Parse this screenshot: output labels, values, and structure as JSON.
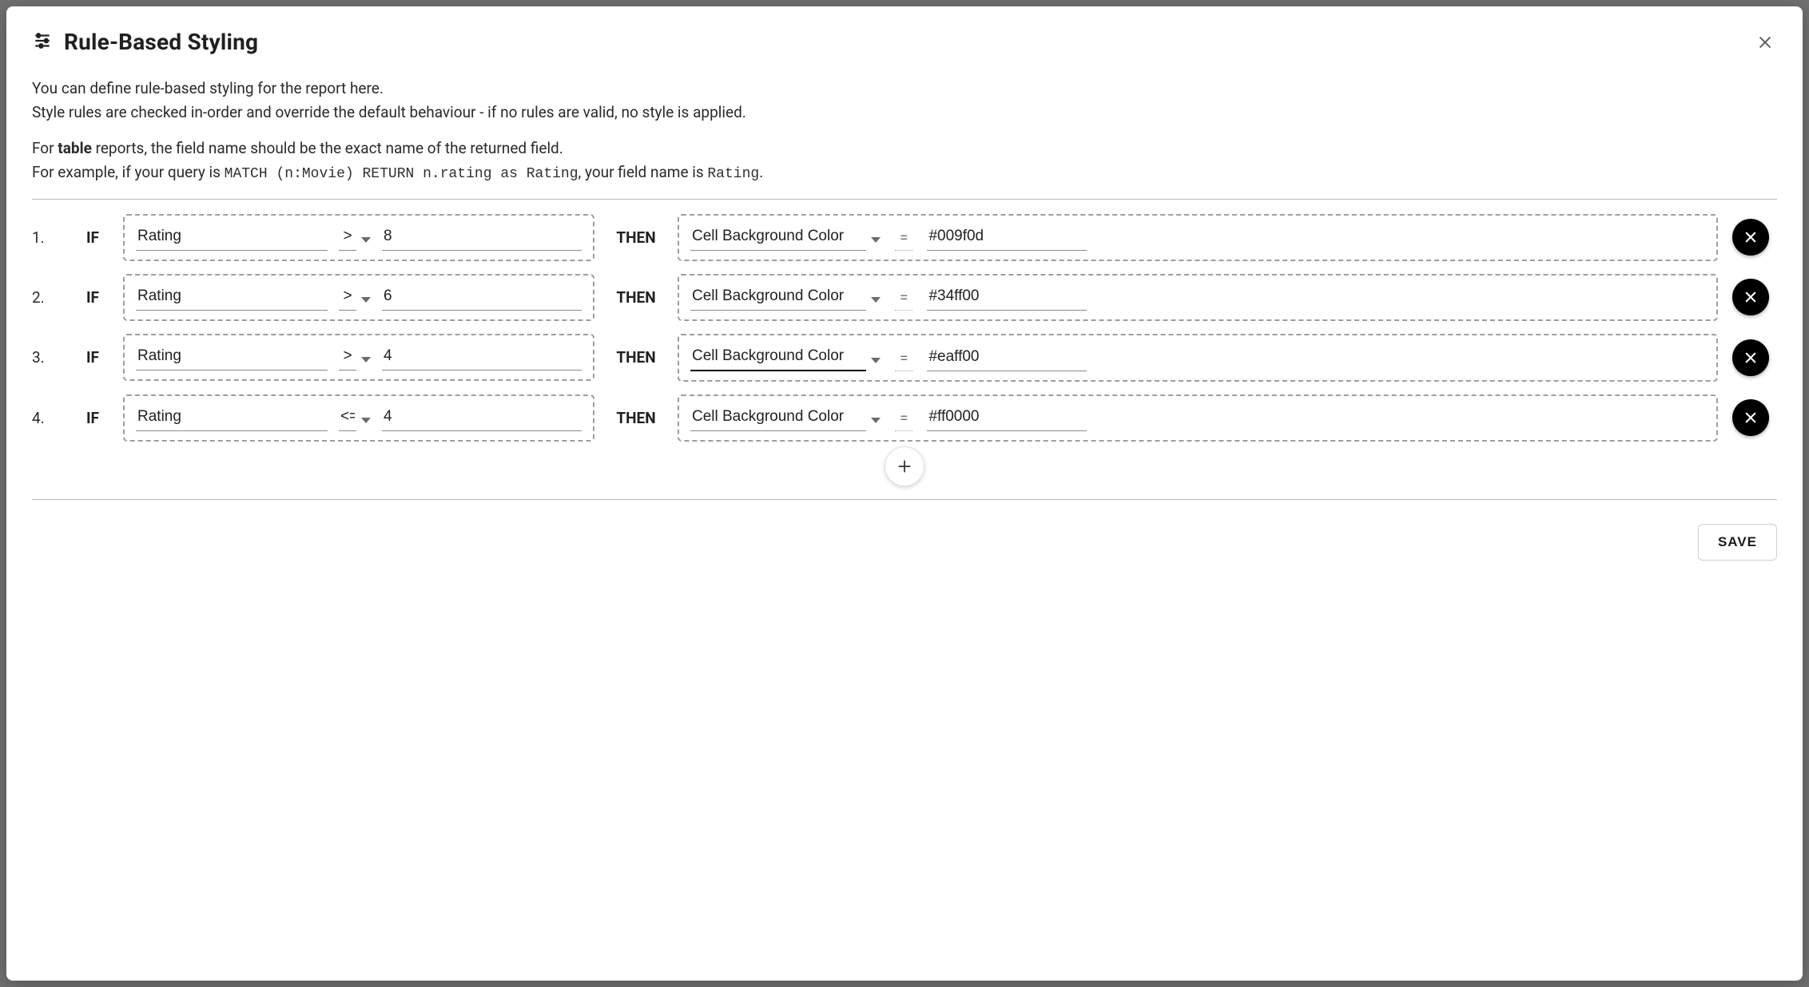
{
  "dialog": {
    "title": "Rule-Based Styling",
    "intro_line1": "You can define rule-based styling for the report here.",
    "intro_line2": "Style rules are checked in-order and override the default behaviour - if no rules are valid, no style is applied.",
    "intro_line3_pre": "For ",
    "intro_line3_bold": "table",
    "intro_line3_post": " reports, the field name should be the exact name of the returned field.",
    "intro_line4_pre": "For example, if your query is ",
    "intro_line4_code": "MATCH (n:Movie) RETURN n.rating as Rating",
    "intro_line4_mid": ", your field name is ",
    "intro_line4_code2": "Rating",
    "intro_line4_post": "."
  },
  "labels": {
    "if": "IF",
    "then": "THEN",
    "equals": "=",
    "save": "SAVE"
  },
  "rules": [
    {
      "index": "1.",
      "field": "Rating",
      "op": ">",
      "value": "8",
      "target": "Cell Background Color",
      "result": "#009f0d",
      "target_focused": false
    },
    {
      "index": "2.",
      "field": "Rating",
      "op": ">",
      "value": "6",
      "target": "Cell Background Color",
      "result": "#34ff00",
      "target_focused": false
    },
    {
      "index": "3.",
      "field": "Rating",
      "op": ">",
      "value": "4",
      "target": "Cell Background Color",
      "result": "#eaff00",
      "target_focused": true
    },
    {
      "index": "4.",
      "field": "Rating",
      "op": "<=",
      "value": "4",
      "target": "Cell Background Color",
      "result": "#ff0000",
      "target_focused": false
    }
  ]
}
